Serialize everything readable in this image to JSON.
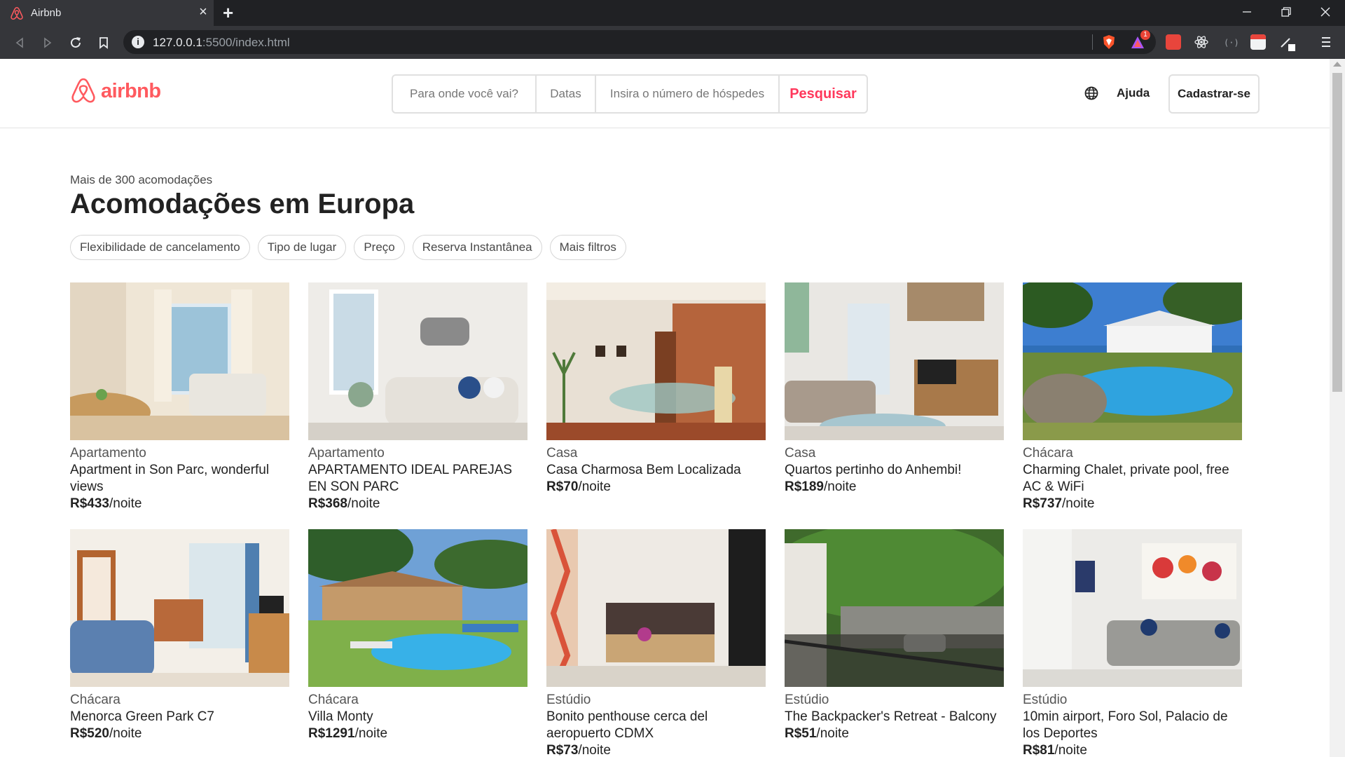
{
  "browser": {
    "tab_title": "Airbnb",
    "tab_close": "×",
    "new_tab": "+",
    "url_host": "127.0.0.1",
    "url_rest": ":5500/index.html",
    "info_glyph": "i",
    "ext_badge": "1"
  },
  "header": {
    "logo_text": "airbnb",
    "brand_color": "#ff5a5f",
    "search": {
      "where": "Para onde você vai?",
      "dates": "Datas",
      "guests": "Insira o número de hóspedes",
      "submit": "Pesquisar"
    },
    "help": "Ajuda",
    "signup": "Cadastrar-se"
  },
  "main": {
    "subtitle": "Mais de 300 acomodações",
    "title": "Acomodações em Europa",
    "filters": [
      "Flexibilidade de cancelamento",
      "Tipo de lugar",
      "Preço",
      "Reserva Instantânea",
      "Mais filtros"
    ]
  },
  "listings": [
    {
      "type": "Apartamento",
      "name": "Apartment in Son Parc, wonderful views",
      "price": "R$433",
      "unit": "/noite"
    },
    {
      "type": "Apartamento",
      "name": "APARTAMENTO IDEAL PAREJAS EN SON PARC",
      "price": "R$368",
      "unit": "/noite"
    },
    {
      "type": "Casa",
      "name": "Casa Charmosa Bem Localizada",
      "price": "R$70",
      "unit": "/noite"
    },
    {
      "type": "Casa",
      "name": "Quartos pertinho do Anhembi!",
      "price": "R$189",
      "unit": "/noite"
    },
    {
      "type": "Chácara",
      "name": "Charming Chalet, private pool, free AC & WiFi",
      "price": "R$737",
      "unit": "/noite"
    },
    {
      "type": "Chácara",
      "name": "Menorca Green Park C7",
      "price": "R$520",
      "unit": "/noite"
    },
    {
      "type": "Chácara",
      "name": "Villa Monty",
      "price": "R$1291",
      "unit": "/noite"
    },
    {
      "type": "Estúdio",
      "name": "Bonito penthouse cerca del aeropuerto CDMX",
      "price": "R$73",
      "unit": "/noite"
    },
    {
      "type": "Estúdio",
      "name": "The Backpacker's Retreat - Balcony",
      "price": "R$51",
      "unit": "/noite"
    },
    {
      "type": "Estúdio",
      "name": "10min airport, Foro Sol, Palacio de los Deportes",
      "price": "R$81",
      "unit": "/noite"
    }
  ]
}
